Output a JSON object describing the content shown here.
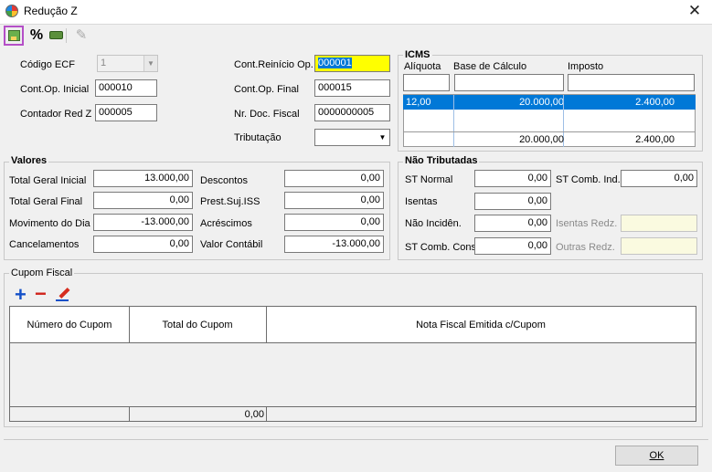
{
  "window": {
    "title": "Redução Z",
    "close_glyph": "✕",
    "app_icon": "palette-icon"
  },
  "toolbar": {
    "save_icon": "save-icon",
    "percent_label": "%",
    "money_icon": "money-icon",
    "edit_icon": "pencil-icon"
  },
  "header": {
    "codigo_ecf_label": "Código ECF",
    "codigo_ecf_value": "1",
    "cont_op_inicial_label": "Cont.Op. Inicial",
    "cont_op_inicial_value": "000010",
    "contador_red_z_label": "Contador Red Z",
    "contador_red_z_value": "000005",
    "cont_reinicio_label": "Cont.Reinício Op.",
    "cont_reinicio_value": "000001",
    "cont_op_final_label": "Cont.Op. Final",
    "cont_op_final_value": "000015",
    "nr_doc_fiscal_label": "Nr. Doc. Fiscal",
    "nr_doc_fiscal_value": "0000000005",
    "tributacao_label": "Tributação",
    "tributacao_value": ""
  },
  "icms": {
    "title": "ICMS",
    "aliquota_label": "Alíquota",
    "base_label": "Base de Cálculo",
    "imposto_label": "Imposto",
    "rows": [
      {
        "aliquota": "12,00",
        "base": "20.000,00",
        "imposto": "2.400,00"
      }
    ],
    "total_base": "20.000,00",
    "total_imposto": "2.400,00"
  },
  "valores": {
    "title": "Valores",
    "total_geral_inicial_label": "Total Geral Inicial",
    "total_geral_inicial_value": "13.000,00",
    "total_geral_final_label": "Total Geral Final",
    "total_geral_final_value": "0,00",
    "movimento_dia_label": "Movimento do Dia",
    "movimento_dia_value": "-13.000,00",
    "cancelamentos_label": "Cancelamentos",
    "cancelamentos_value": "0,00",
    "descontos_label": "Descontos",
    "descontos_value": "0,00",
    "prest_iss_label": "Prest.Suj.ISS",
    "prest_iss_value": "0,00",
    "acrescimos_label": "Acréscimos",
    "acrescimos_value": "0,00",
    "valor_contabil_label": "Valor Contábil",
    "valor_contabil_value": "-13.000,00"
  },
  "nao_tributadas": {
    "title": "Não Tributadas",
    "st_normal_label": "ST Normal",
    "st_normal_value": "0,00",
    "isentas_label": "Isentas",
    "isentas_value": "0,00",
    "nao_incid_label": "Não Incidên.",
    "nao_incid_value": "0,00",
    "st_comb_cons_label": "ST Comb. Cons",
    "st_comb_cons_value": "0,00",
    "st_comb_ind_label": "ST Comb. Ind.",
    "st_comb_ind_value": "0,00",
    "isentas_redz_label": "Isentas Redz.",
    "isentas_redz_value": "",
    "outras_redz_label": "Outras Redz.",
    "outras_redz_value": ""
  },
  "cupom": {
    "title": "Cupom Fiscal",
    "add_icon": "plus-icon",
    "remove_icon": "minus-icon",
    "edit_icon": "pencil-icon",
    "columns": [
      "Número do Cupom",
      "Total do Cupom",
      "Nota Fiscal Emitida c/Cupom"
    ],
    "total": "0,00"
  },
  "footer": {
    "ok_label": "OK"
  }
}
